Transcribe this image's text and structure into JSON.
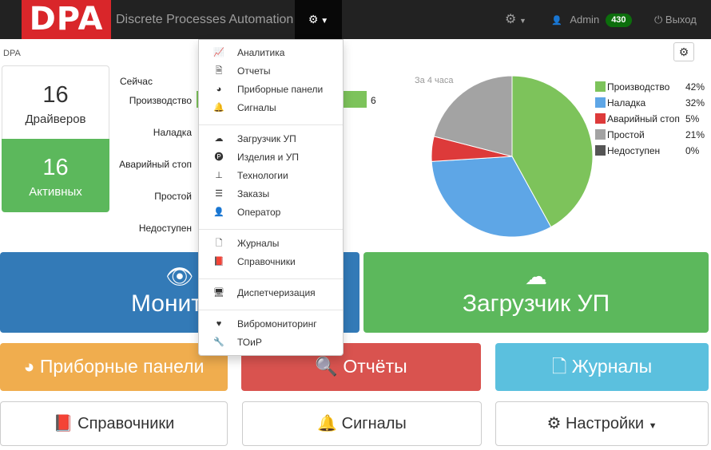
{
  "navbar": {
    "logo_text": "DPA",
    "brand": "Discrete Processes Automation",
    "settings_caret": "▾",
    "user": "Admin",
    "user_badge": "430",
    "logout": "Выход"
  },
  "breadcrumb": "DPA",
  "drivers": {
    "total_value": "16",
    "total_label": "Драйверов",
    "active_value": "16",
    "active_label": "Активных"
  },
  "now_chart": {
    "heading": "Сейчас",
    "rows": [
      {
        "label": "Производство",
        "value": "6"
      },
      {
        "label": "Наладка",
        "value": ""
      },
      {
        "label": "Аварийный стоп",
        "value": ""
      },
      {
        "label": "Простой",
        "value": ""
      },
      {
        "label": "Недоступен",
        "value": ""
      }
    ]
  },
  "chart_data": {
    "type": "pie",
    "title": "За 4 часа",
    "slices": [
      {
        "label": "Производство",
        "value": 42,
        "color": "#7dc35b"
      },
      {
        "label": "Наладка",
        "value": 32,
        "color": "#5ea6e6"
      },
      {
        "label": "Аварийный стоп",
        "value": 5,
        "color": "#dd3a3a"
      },
      {
        "label": "Простой",
        "value": 21,
        "color": "#a3a3a3"
      },
      {
        "label": "Недоступен",
        "value": 0,
        "color": "#555555"
      }
    ],
    "legend": "right",
    "pct_labels": [
      "42%",
      "32%",
      "5%",
      "21%",
      "0%"
    ]
  },
  "tiles": {
    "monitor": "Монитор",
    "loader": "Загрузчик УП",
    "panels": "Приборные панели",
    "reports": "Отчёты",
    "journals": "Журналы",
    "dictionaries": "Справочники",
    "signals": "Сигналы",
    "settings": "Настройки"
  },
  "dropdown": {
    "items": [
      {
        "label": "Аналитика",
        "icon": "line-chart-icon",
        "glyph": "📈"
      },
      {
        "label": "Отчеты",
        "icon": "pdf-file-icon",
        "glyph": "🗎"
      },
      {
        "label": "Приборные панели",
        "icon": "dashboard-icon",
        "glyph": "◕"
      },
      {
        "label": "Сигналы",
        "icon": "bell-icon",
        "glyph": "🔔"
      },
      {
        "label": "Загрузчик УП",
        "icon": "cloud-download-icon",
        "glyph": "☁"
      },
      {
        "label": "Изделия и УП",
        "icon": "product-icon",
        "glyph": "🅟"
      },
      {
        "label": "Технологии",
        "icon": "sitemap-icon",
        "glyph": "⊥"
      },
      {
        "label": "Заказы",
        "icon": "list-icon",
        "glyph": "☰"
      },
      {
        "label": "Оператор",
        "icon": "user-icon",
        "glyph": "👤"
      },
      {
        "label": "Журналы",
        "icon": "file-text-icon",
        "glyph": "🗋"
      },
      {
        "label": "Справочники",
        "icon": "book-icon",
        "glyph": "📕"
      },
      {
        "label": "Диспетчеризация",
        "icon": "monitor-icon",
        "glyph": "🖥"
      },
      {
        "label": "Вибромониторинг",
        "icon": "heartbeat-icon",
        "glyph": "♥"
      },
      {
        "label": "ТОиР",
        "icon": "wrench-icon",
        "glyph": "🔧"
      }
    ]
  },
  "colors": {
    "green": "#5cb85c",
    "blue": "#337ab7",
    "orange": "#f0ad4e",
    "red": "#d9534f",
    "cyan": "#5bc0de",
    "logo_red": "#d9262a"
  }
}
